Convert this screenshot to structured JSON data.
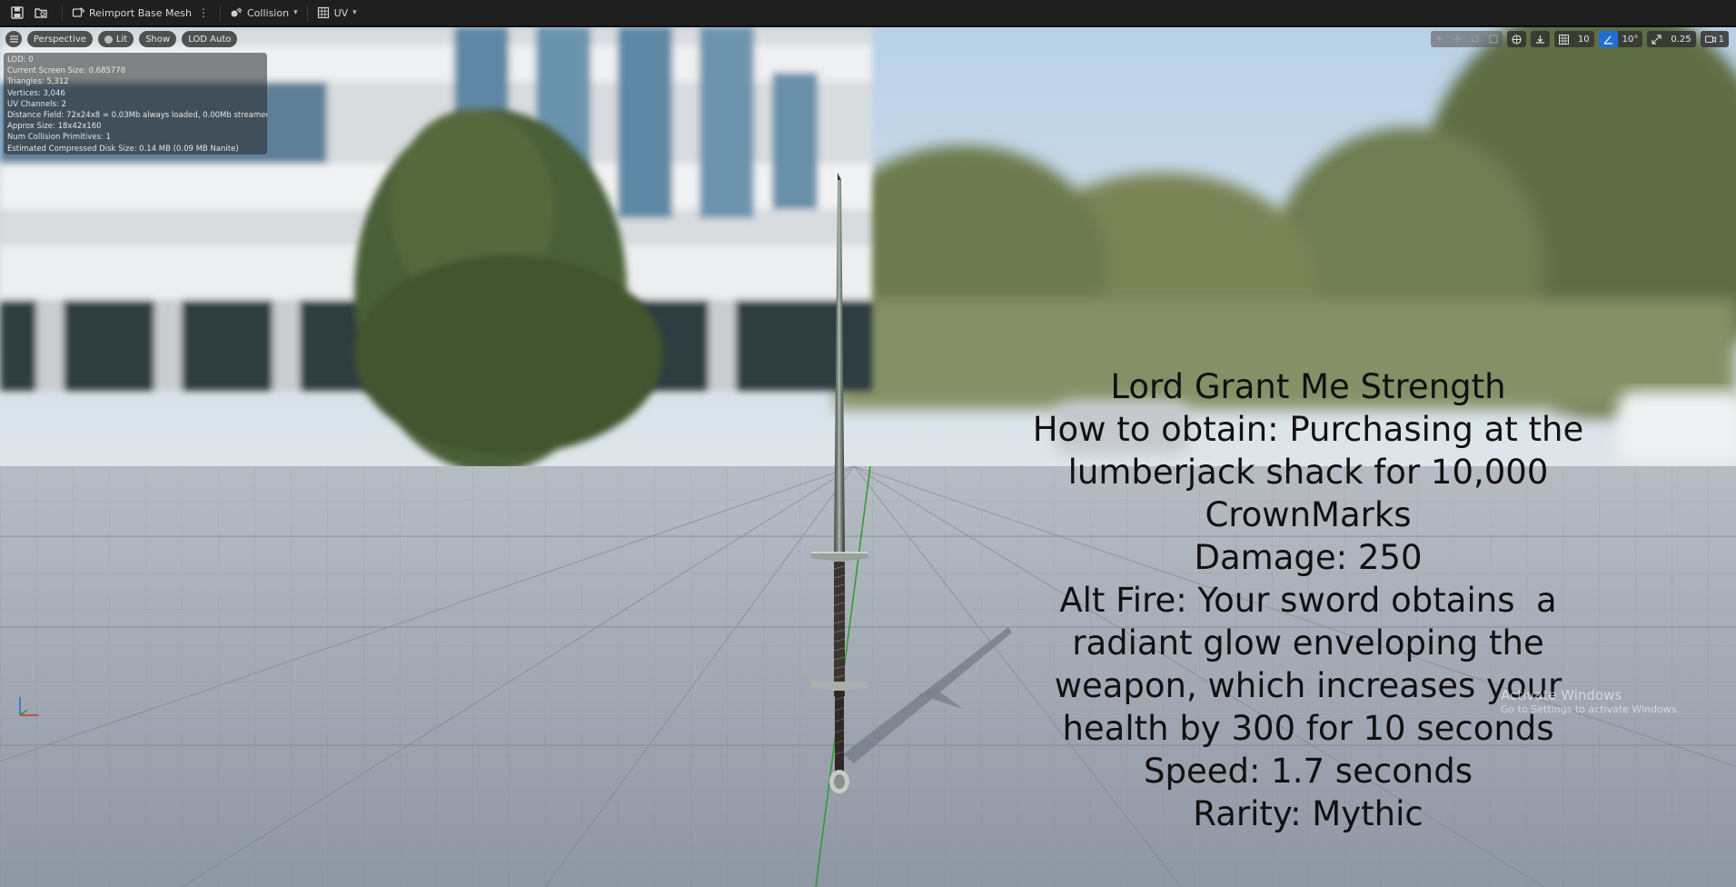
{
  "toolbar": {
    "save_icon": "save-icon",
    "browse_icon": "browse-asset-icon",
    "reimport_label": "Reimport Base Mesh",
    "collision_label": "Collision",
    "uv_label": "UV"
  },
  "viewport_controls": {
    "menu_icon": "hamburger-icon",
    "perspective_label": "Perspective",
    "lit_label": "Lit",
    "show_label": "Show",
    "lod_label": "LOD Auto"
  },
  "stats": {
    "lines": [
      "LOD: 0",
      "Current Screen Size: 0.685778",
      "Triangles: 5,312",
      "Vertices: 3,046",
      "UV Channels: 2",
      "Distance Field: 72x24x8 = 0.03Mb always loaded, 0.00Mb streamed",
      "Approx Size: 18x42x160",
      "Num Collision Primitives: 1",
      "Estimated Compressed Disk Size: 0.14 MB (0.09 MB Nanite)"
    ]
  },
  "right_controls": {
    "grid_snap_value": "10",
    "rotation_snap_value": "10°",
    "scale_snap_value": "0.25",
    "camera_speed_value": "1"
  },
  "weapon_info": {
    "lines": [
      "Lord Grant Me Strength",
      "How to obtain: Purchasing at the",
      "lumberjack shack for 10,000",
      "CrownMarks",
      "Damage: 250",
      "Alt Fire: Your sword obtains  a",
      "radiant glow enveloping the",
      "weapon, which increases your",
      "health by 300 for 10 seconds",
      "Speed: 1.7 seconds",
      "Rarity: Mythic"
    ]
  },
  "watermark": {
    "title": "Activate Windows",
    "subtitle": "Go to Settings to activate Windows."
  },
  "colors": {
    "toolbar_bg": "#1f1f1f",
    "accent": "#1e6fd0",
    "floor": "#a3aab4",
    "sky": "#c9d9e8"
  }
}
